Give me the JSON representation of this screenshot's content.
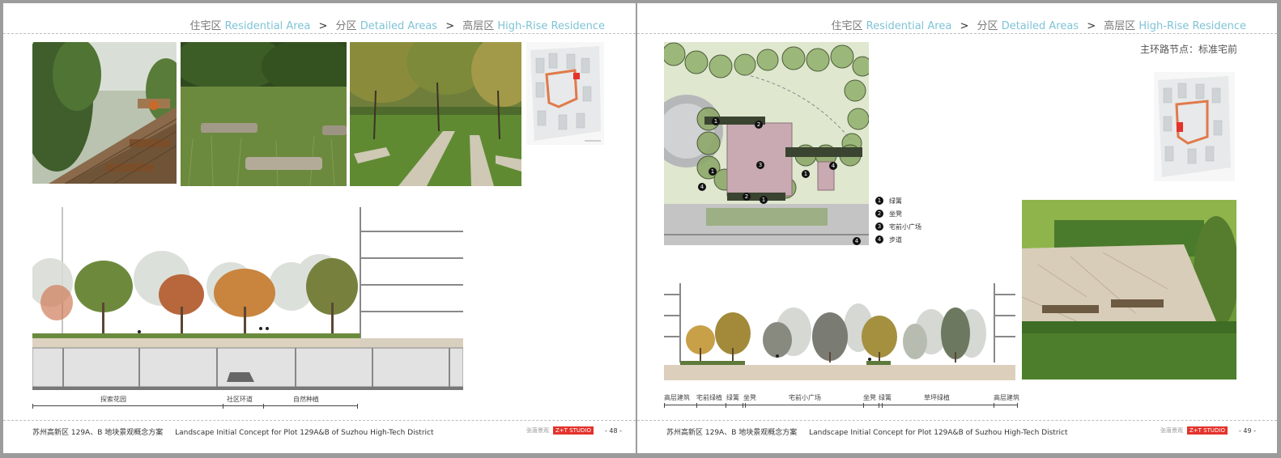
{
  "left_page": {
    "breadcrumb": {
      "l1_cn": "住宅区",
      "l1_en": "Residential Area",
      "l2_cn": "分区",
      "l2_en": "Detailed Areas",
      "l3_cn": "高层区",
      "l3_en": "High-Rise Residence",
      "separator": ">"
    },
    "section_labels": [
      "探索花园",
      "社区环道",
      "自然种植"
    ],
    "footer": {
      "cn": "苏州高新区 129A、B 地块景观概念方案",
      "en": "Landscape Initial Concept for Plot 129A&B of Suzhou High-Tech District",
      "brand": "张唐景观",
      "logo": "Z+T STUDIO",
      "page": "- 48 -"
    }
  },
  "right_page": {
    "breadcrumb": {
      "l1_cn": "住宅区",
      "l1_en": "Residential Area",
      "l2_cn": "分区",
      "l2_en": "Detailed Areas",
      "l3_cn": "高层区",
      "l3_en": "High-Rise Residence",
      "separator": ">"
    },
    "node_title": "主环路节点：标准宅前",
    "legend": [
      {
        "num": "1",
        "label": "绿篱"
      },
      {
        "num": "2",
        "label": "坐凳"
      },
      {
        "num": "3",
        "label": "宅前小广场"
      },
      {
        "num": "4",
        "label": "步道"
      }
    ],
    "section_labels": [
      "高层建筑",
      "宅前绿植",
      "绿篱",
      "坐凳",
      "宅前小广场",
      "坐凳",
      "绿篱",
      "草坪绿植",
      "高层建筑"
    ],
    "footer": {
      "cn": "苏州高新区 129A、B 地块景观概念方案",
      "en": "Landscape Initial Concept for Plot 129A&B of Suzhou High-Tech District",
      "brand": "张唐景观",
      "logo": "Z+T STUDIO",
      "page": "- 49 -"
    }
  },
  "colors": {
    "accent_blue": "#7fc3d6",
    "logo_red": "#e4322b",
    "route_orange": "#e07a4a"
  }
}
